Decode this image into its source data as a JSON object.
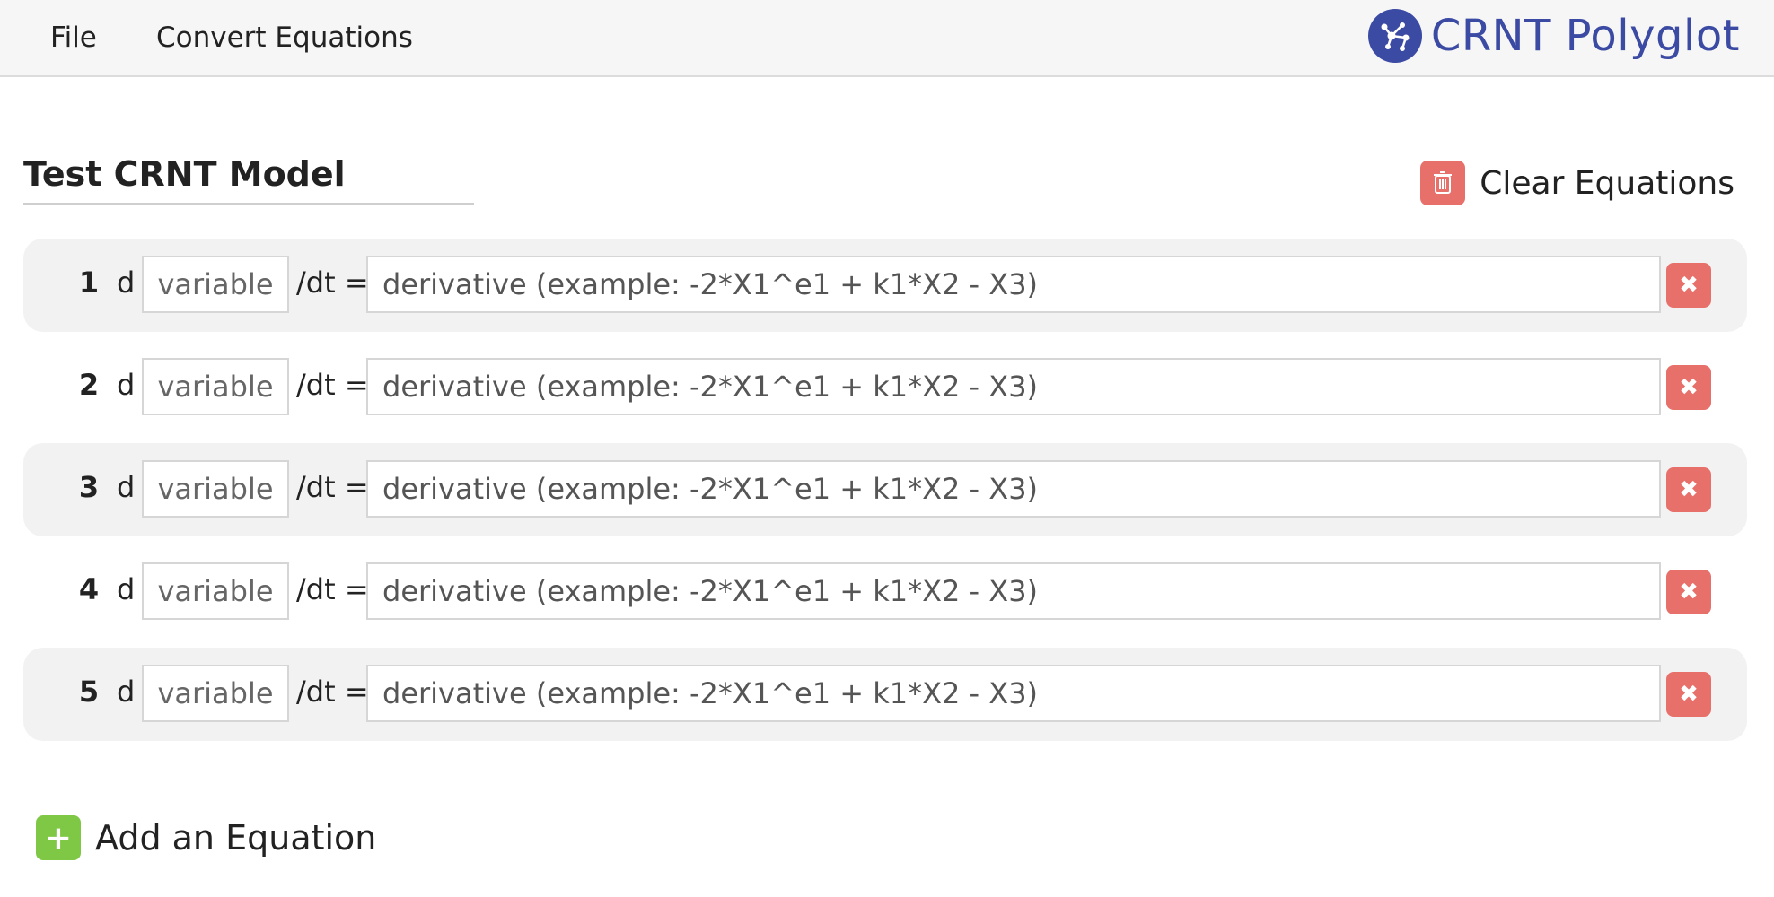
{
  "nav": {
    "file_label": "File",
    "convert_label": "Convert Equations",
    "brand_name": "CRNT Polyglot",
    "brand_icon": "network-graph-icon"
  },
  "model": {
    "title": "Test CRNT Model",
    "clear_label": "Clear Equations",
    "clear_icon": "trash-icon"
  },
  "equations": [
    {
      "number": "1",
      "d_label": "d",
      "variable_placeholder": "variable",
      "dt_label": "/dt =",
      "derivative_placeholder": "derivative (example: -2*X1^e1 + k1*X2 - X3)",
      "delete_icon": "close-icon"
    },
    {
      "number": "2",
      "d_label": "d",
      "variable_placeholder": "variable",
      "dt_label": "/dt =",
      "derivative_placeholder": "derivative (example: -2*X1^e1 + k1*X2 - X3)",
      "delete_icon": "close-icon"
    },
    {
      "number": "3",
      "d_label": "d",
      "variable_placeholder": "variable",
      "dt_label": "/dt =",
      "derivative_placeholder": "derivative (example: -2*X1^e1 + k1*X2 - X3)",
      "delete_icon": "close-icon"
    },
    {
      "number": "4",
      "d_label": "d",
      "variable_placeholder": "variable",
      "dt_label": "/dt =",
      "derivative_placeholder": "derivative (example: -2*X1^e1 + k1*X2 - X3)",
      "delete_icon": "close-icon"
    },
    {
      "number": "5",
      "d_label": "d",
      "variable_placeholder": "variable",
      "dt_label": "/dt =",
      "derivative_placeholder": "derivative (example: -2*X1^e1 + k1*X2 - X3)",
      "delete_icon": "close-icon"
    }
  ],
  "add": {
    "label": "Add an Equation",
    "icon": "plus-icon"
  },
  "colors": {
    "brand": "#3b4aa3",
    "danger": "#e8706a",
    "success": "#7fc845",
    "row_alt_bg": "#f2f2f2",
    "navbar_bg": "#f6f6f6"
  }
}
